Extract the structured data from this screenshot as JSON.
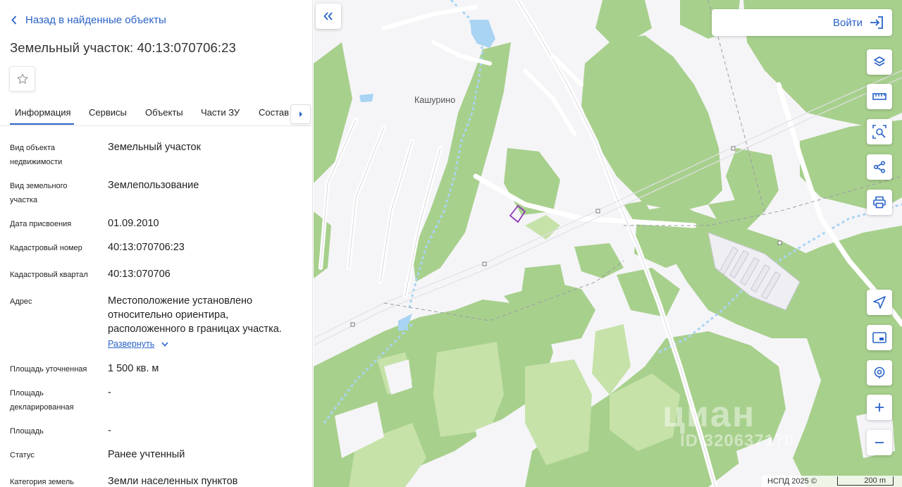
{
  "back_link": "Назад в найденные объекты",
  "title": "Земельный участок: 40:13:070706:23",
  "tabs": [
    "Информация",
    "Сервисы",
    "Объекты",
    "Части ЗУ",
    "Состав"
  ],
  "rows": [
    {
      "label": "Вид объекта недвижимости",
      "value": "Земельный участок"
    },
    {
      "label": "Вид земельного участка",
      "value": "Землепользование"
    },
    {
      "label": "Дата присвоения",
      "value": "01.09.2010"
    },
    {
      "label": "Кадастровый номер",
      "value": "40:13:070706:23"
    },
    {
      "label": "Кадастровый квартал",
      "value": "40:13:070706"
    },
    {
      "label": "Адрес",
      "value": "Местоположение установлено относительно ориентира, расположенного в границах участка."
    },
    {
      "label": "Площадь уточненная",
      "value": "1 500 кв. м"
    },
    {
      "label": "Площадь декларированная",
      "value": "-"
    },
    {
      "label": "Площадь",
      "value": "-"
    },
    {
      "label": "Статус",
      "value": "Ранее учтенный"
    },
    {
      "label": "Категория земель",
      "value": "Земли населенных пунктов"
    }
  ],
  "expand_label": "Развернуть",
  "map": {
    "login_label": "Войти",
    "village_label": "Кашурино",
    "watermark": "циан",
    "watermark_id": "ID 320637170",
    "attribution": "НСПД 2025 ©",
    "scale_label": "200 m",
    "colors": {
      "forest": "#a8d08d",
      "forest_light": "#c6e2a9",
      "water": "#a9d4f3",
      "parcel": "#8e3bb5",
      "accent": "#2a63c8"
    }
  },
  "icons": {
    "back": "chevron-left-icon",
    "favorite": "star-icon",
    "tabs_next": "caret-right-icon",
    "collapse": "double-chevron-left-icon",
    "login": "login-icon",
    "map_buttons": [
      "layers-icon",
      "ruler-icon",
      "area-select-icon",
      "share-icon",
      "print-icon",
      "locate-icon",
      "minimap-icon",
      "geo-search-icon",
      "zoom-in-icon",
      "zoom-out-icon"
    ]
  }
}
